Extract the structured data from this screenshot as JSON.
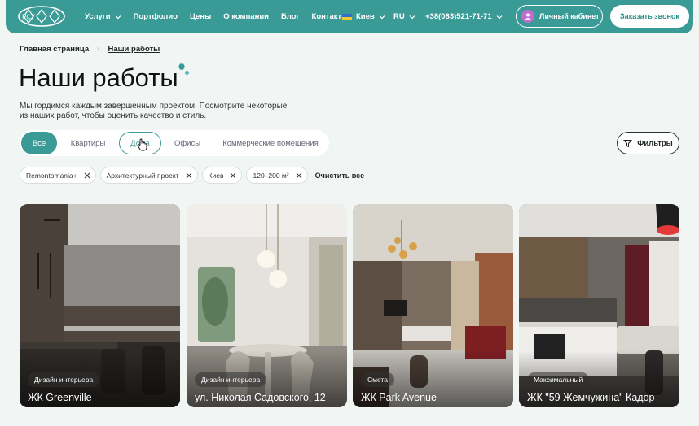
{
  "header": {
    "logo_letters": "РСУ",
    "nav": [
      {
        "label": "Услуги",
        "dropdown": true
      },
      {
        "label": "Портфолио",
        "dropdown": false
      },
      {
        "label": "Цены",
        "dropdown": false
      },
      {
        "label": "О компании",
        "dropdown": false
      },
      {
        "label": "Блог",
        "dropdown": false
      },
      {
        "label": "Контакты",
        "dropdown": false
      }
    ],
    "city": "Киев",
    "language": "RU",
    "phone": "+38(063)521-71-71",
    "cabinet_label": "Личный кабинет",
    "call_button": "Заказать звонок",
    "colors": {
      "primary": "#3a9a96",
      "avatar": "#c26bd2"
    }
  },
  "breadcrumb": {
    "home": "Главная страница",
    "separator": "›",
    "current": "Наши работы"
  },
  "page": {
    "title": "Наши работы",
    "intro": "Мы гордимся каждым завершенным проектом. Посмотрите некоторые из наших работ, чтобы оценить качество и стиль."
  },
  "tabs": {
    "items": [
      {
        "label": "Все",
        "state": "active"
      },
      {
        "label": "Квартиры",
        "state": "normal"
      },
      {
        "label": "Дома",
        "state": "hover"
      },
      {
        "label": "Офисы",
        "state": "normal"
      },
      {
        "label": "Коммерческие помещения",
        "state": "normal"
      }
    ],
    "filters_button": "Фильтры"
  },
  "chips": {
    "items": [
      "Remontomania+",
      "Архитектурный проект",
      "Киев",
      "120–200 м²"
    ],
    "clear_all": "Очистить все"
  },
  "cards": [
    {
      "tag": "Дизайн интерьера",
      "name": "ЖК Greenville",
      "icon": "kitchen-photo"
    },
    {
      "tag": "Дизайн интерьера",
      "name": "ул. Николая Садовского, 12",
      "icon": "dining-photo"
    },
    {
      "tag": "Смета",
      "name": "ЖК Park Avenue",
      "icon": "living-photo"
    },
    {
      "tag": "Максимальный",
      "name": "ЖК \"59 Жемчужина\" Кадор",
      "icon": "studio-photo"
    }
  ]
}
